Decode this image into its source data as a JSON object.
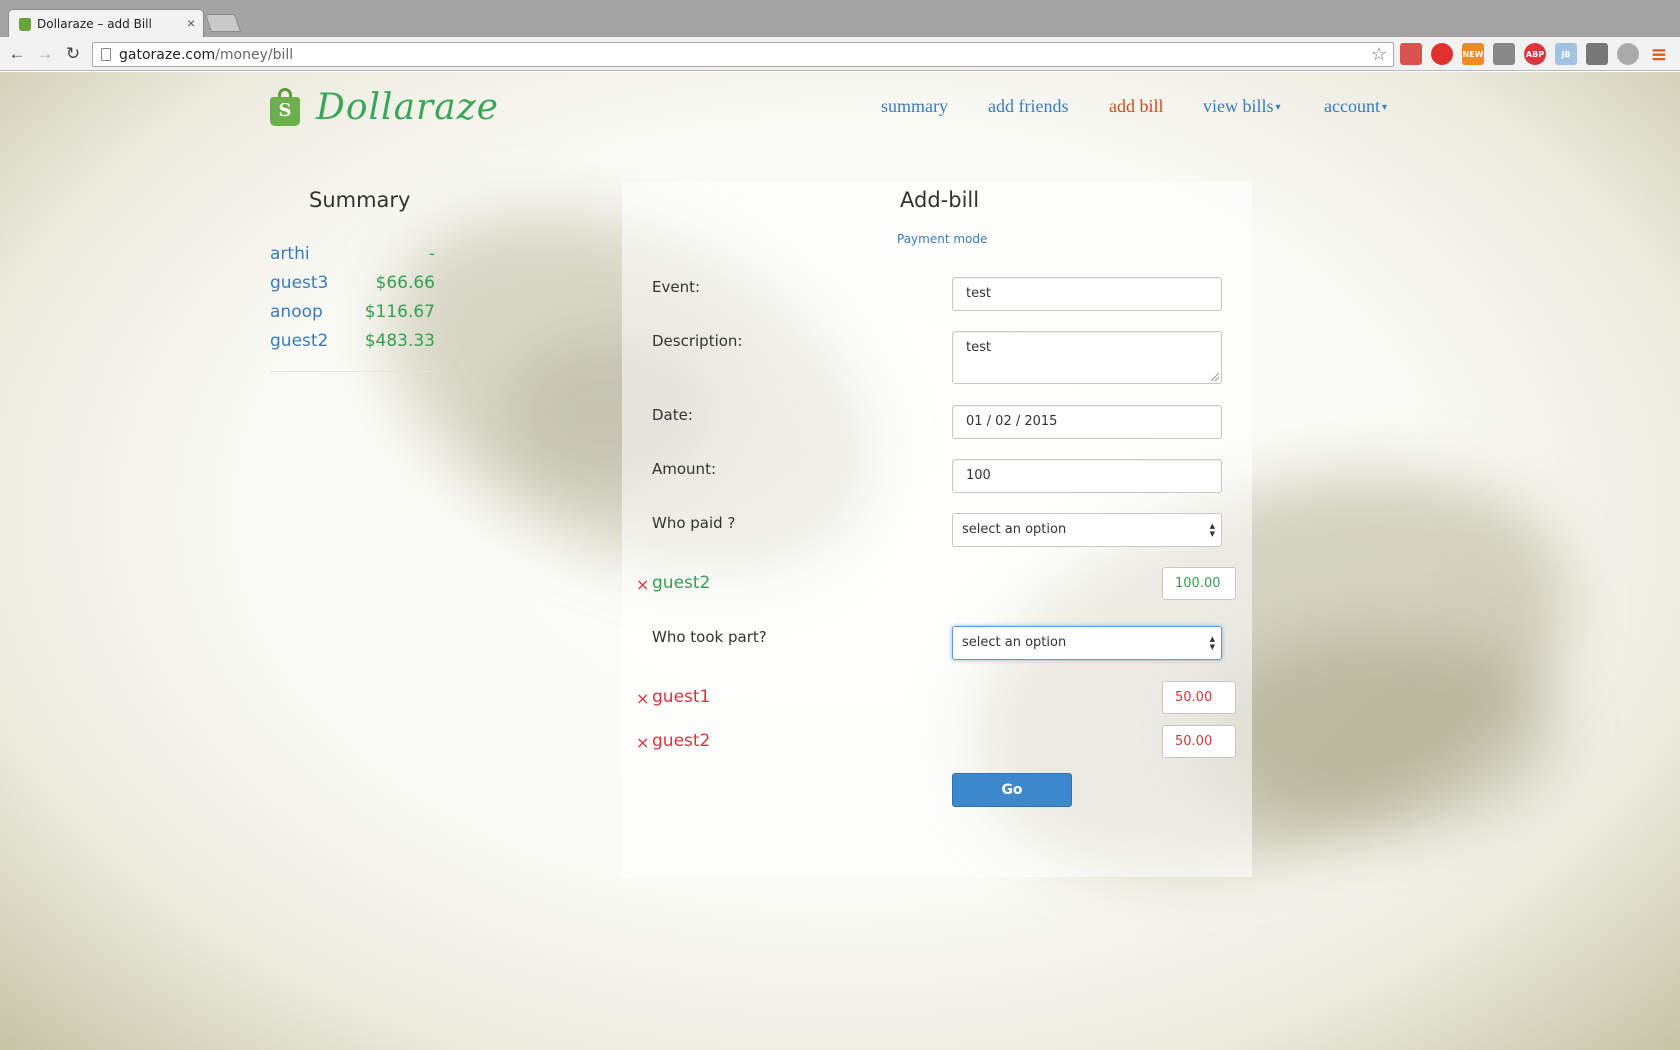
{
  "browser": {
    "tab_title": "Dollaraze – add Bill",
    "tab_close": "×",
    "url_host": "gatoraze.com",
    "url_path": "/money/bill",
    "back_icon": "←",
    "forward_icon": "→",
    "reload_icon": "↻",
    "star_icon": "☆",
    "menu_icon": "≡",
    "extension_labels": [
      "",
      "",
      "NEW",
      "",
      "ABP",
      "JB",
      "",
      ""
    ]
  },
  "brand": {
    "name": "Dollaraze",
    "logo_letter": "S"
  },
  "nav": {
    "items": [
      {
        "label": "summary",
        "active": false,
        "dropdown": false
      },
      {
        "label": "add friends",
        "active": false,
        "dropdown": false
      },
      {
        "label": "add bill",
        "active": true,
        "dropdown": false
      },
      {
        "label": "view bills",
        "active": false,
        "dropdown": true
      },
      {
        "label": "account",
        "active": false,
        "dropdown": true
      }
    ],
    "caret": "▾"
  },
  "summary": {
    "title": "Summary",
    "rows": [
      {
        "name": "arthi",
        "amount": "-"
      },
      {
        "name": "guest3",
        "amount": "$66.66"
      },
      {
        "name": "anoop",
        "amount": "$116.67"
      },
      {
        "name": "guest2",
        "amount": "$483.33"
      }
    ]
  },
  "form": {
    "title": "Add-bill",
    "payment_mode": "Payment mode",
    "event_label": "Event:",
    "event_value": "test",
    "description_label": "Description:",
    "description_value": "test",
    "date_label": "Date:",
    "date_value": "01 / 02 / 2015",
    "amount_label": "Amount:",
    "amount_value": "100",
    "who_paid_label": "Who paid ?",
    "who_paid_select": "select an option",
    "payers": [
      {
        "name": "guest2",
        "amount": "100.00"
      }
    ],
    "who_took_part_label": "Who took part?",
    "who_took_part_select": "select an option",
    "participants": [
      {
        "name": "guest1",
        "amount": "50.00"
      },
      {
        "name": "guest2",
        "amount": "50.00"
      }
    ],
    "remove_icon": "×",
    "select_arrows": "▲▼",
    "submit_label": "Go"
  },
  "colors": {
    "link_blue": "#3a7bbf",
    "active_orange": "#d04a1f",
    "green": "#33a04f",
    "red": "#d9363e",
    "button_blue": "#3d88cc"
  }
}
